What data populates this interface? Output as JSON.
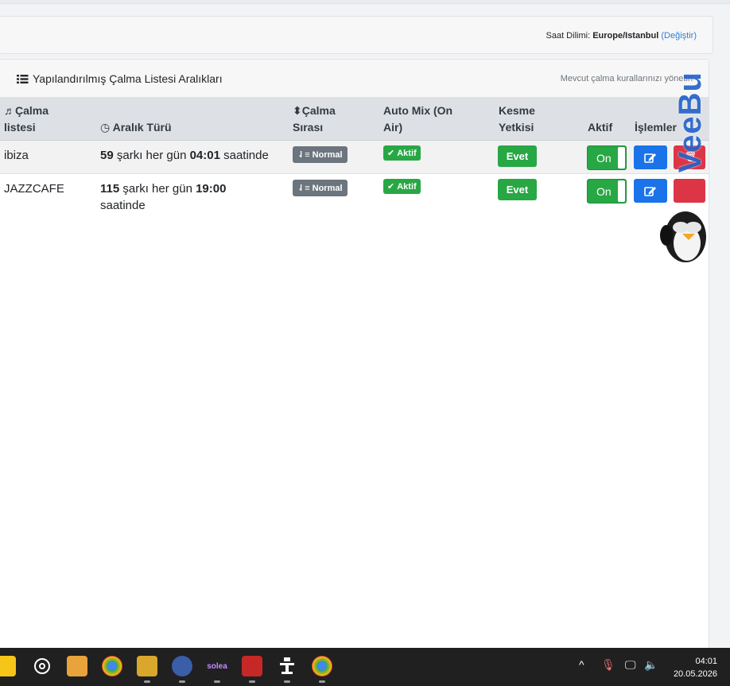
{
  "timezone": {
    "label": "Saat Dilimi:",
    "value": "Europe/Istanbul",
    "change_link": "(Değiştir)"
  },
  "card": {
    "title": "Yapılandırılmış Çalma Listesi Aralıkları",
    "subtitle": "Mevcut çalma kurallarınızı yönetin"
  },
  "table": {
    "headers": {
      "playlist_l1": "Çalma",
      "playlist_l2": "listesi",
      "interval": "Aralık Türü",
      "order_l1": "Çalma",
      "order_l2": "Sırası",
      "automix_l1": "Auto Mix (On",
      "automix_l2": "Air)",
      "cut_l1": "Kesme",
      "cut_l2": "Yetkisi",
      "active": "Aktif",
      "actions": "İşlemler"
    },
    "rows": [
      {
        "playlist": "ibiza",
        "count": "59",
        "mid": "şarkı her gün",
        "time": "04:01",
        "suffix": "saatinde",
        "order": "Normal",
        "automix": "Aktif",
        "cut": "Evet",
        "active": "On"
      },
      {
        "playlist": "JAZZCAFE",
        "count": "115",
        "mid": "şarkı her gün",
        "time": "19:00",
        "suffix": "saatinde",
        "order": "Normal",
        "automix": "Aktif",
        "cut": "Evet",
        "active": "On"
      }
    ]
  },
  "watermark": "VeeBu",
  "colors": {
    "success": "#28a745",
    "primary": "#1a73e8",
    "danger": "#dc3545",
    "secondary": "#6c757d"
  },
  "taskbar": {
    "icons": [
      "explorer-icon",
      "chatgpt-icon",
      "folder-icon",
      "chrome-icon",
      "tool-icon",
      "network-icon",
      "solea-icon",
      "flash-icon",
      "app-icon",
      "chrome-profile-icon"
    ],
    "solea_text": "solea",
    "time": "04:01",
    "date": "20.05.2026"
  }
}
